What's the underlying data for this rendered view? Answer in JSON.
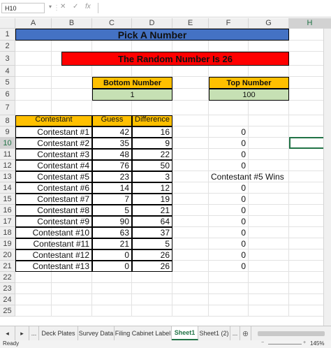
{
  "formula_bar": {
    "name_box": "H10",
    "cancel_icon": "✕",
    "enter_icon": "✓",
    "fx_icon": "fx",
    "formula": ""
  },
  "columns": [
    "A",
    "B",
    "C",
    "D",
    "E",
    "F",
    "G",
    "H"
  ],
  "rows": [
    "1",
    "2",
    "3",
    "4",
    "5",
    "6",
    "7",
    "8",
    "9",
    "10",
    "11",
    "12",
    "13",
    "14",
    "15",
    "16",
    "17",
    "18",
    "19",
    "20",
    "21",
    "22",
    "23",
    "24",
    "25"
  ],
  "selected_cell": {
    "column": "H",
    "row": "10"
  },
  "sheet": {
    "title": "Pick A Number",
    "random_banner": "The Random Number Is 26",
    "bottom_label": "Bottom Number",
    "bottom_value": "1",
    "top_label": "Top Number",
    "top_value": "100",
    "headers": {
      "contestant": "Contestant",
      "guess": "Guess",
      "difference": "Difference"
    },
    "contestants": [
      {
        "name": "Contestant #1",
        "guess": "42",
        "difference": "16",
        "f": "0"
      },
      {
        "name": "Contestant #2",
        "guess": "35",
        "difference": "9",
        "f": "0"
      },
      {
        "name": "Contestant #3",
        "guess": "48",
        "difference": "22",
        "f": "0"
      },
      {
        "name": "Contestant #4",
        "guess": "76",
        "difference": "50",
        "f": "0"
      },
      {
        "name": "Contestant #5",
        "guess": "23",
        "difference": "3",
        "f": "Contestant  #5 Wins"
      },
      {
        "name": "Contestant #6",
        "guess": "14",
        "difference": "12",
        "f": "0"
      },
      {
        "name": "Contestant #7",
        "guess": "7",
        "difference": "19",
        "f": "0"
      },
      {
        "name": "Contestant #8",
        "guess": "5",
        "difference": "21",
        "f": "0"
      },
      {
        "name": "Contestant #9",
        "guess": "90",
        "difference": "64",
        "f": "0"
      },
      {
        "name": "Contestant #10",
        "guess": "63",
        "difference": "37",
        "f": "0"
      },
      {
        "name": "Contestant #11",
        "guess": "21",
        "difference": "5",
        "f": "0"
      },
      {
        "name": "Contestant #12",
        "guess": "0",
        "difference": "26",
        "f": "0"
      },
      {
        "name": "Contestant #13",
        "guess": "0",
        "difference": "26",
        "f": "0"
      }
    ]
  },
  "tabs": {
    "items": [
      "...",
      "Deck Plates",
      "Survey Data",
      "Filing Cabinet Label",
      "Sheet1",
      "Sheet1 (2)",
      "..."
    ],
    "active": "Sheet1",
    "add_icon": "⊕"
  },
  "status": {
    "ready": "Ready",
    "zoom": "145%"
  },
  "colors": {
    "title_fill": "#4472c4",
    "banner_fill": "#ff0000",
    "header_fill": "#ffc000",
    "value_fill": "#c6e0b4",
    "selection": "#217346"
  }
}
